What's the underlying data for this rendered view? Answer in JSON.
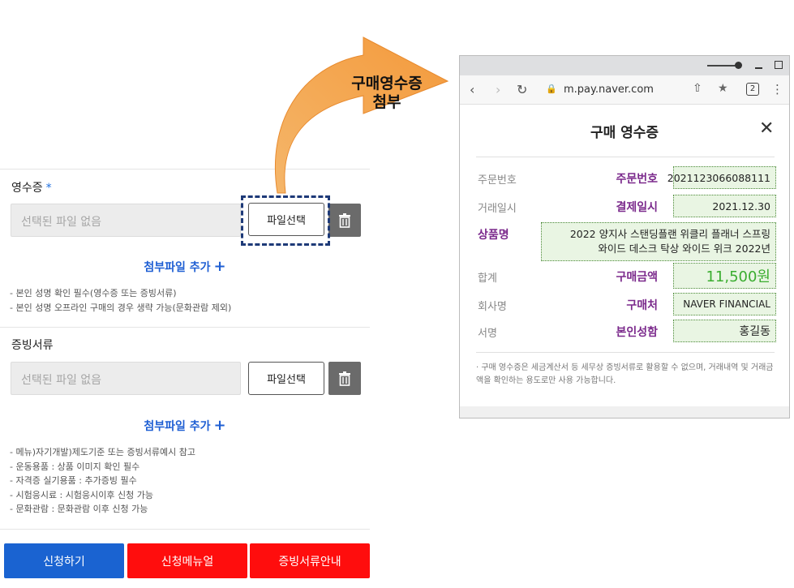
{
  "arrow": {
    "line1": "구매영수증",
    "line2": "첨부"
  },
  "form": {
    "receipt": {
      "title": "영수증",
      "required_mark": "*",
      "placeholder": "선택된 파일 없음",
      "select_button": "파일선택",
      "add_link": "첨부파일 추가",
      "add_icon": "+",
      "notes": [
        "- 본인 성명 확인 필수(영수증 또는 증빙서류)",
        "- 본인 성명 오프라인 구매의 경우 생략 가능(문화관람 제외)"
      ]
    },
    "evidence": {
      "title": "증빙서류",
      "placeholder": "선택된 파일 없음",
      "select_button": "파일선택",
      "add_link": "첨부파일 추가",
      "add_icon": "+",
      "notes": [
        "- 메뉴)자기개발)제도기준 또는 증빙서류예시 참고",
        "- 운동용품 : 상품 이미지 확인 필수",
        "- 자격증 실기용품 : 추가증빙 필수",
        "- 시험응시료 : 시험응시이후 신청 가능",
        "- 문화관람 : 문화관람 이후 신청 가능"
      ]
    },
    "buttons": {
      "apply": "신청하기",
      "manual": "신청메뉴얼",
      "guide": "증빙서류안내"
    }
  },
  "browser": {
    "url": "m.pay.naver.com",
    "tab_count": "2",
    "receipt": {
      "title": "구매 영수증",
      "rows": [
        {
          "label": "주문번호",
          "key": "주문번호",
          "value": "2021123066088111"
        },
        {
          "label": "거래일시",
          "key": "결제일시",
          "value": "2021.12.30"
        },
        {
          "label": "상품명",
          "key": "",
          "value_line1": "2022 양지사 스탠딩플랜 위클리 플래너 스프링",
          "value_line2": "와이드 데스크 탁상 와이드 위크 2022년"
        },
        {
          "label": "합계",
          "key": "구매금액",
          "value": "11,500원"
        },
        {
          "label": "회사명",
          "key": "구매처",
          "value": "NAVER FINANCIAL"
        },
        {
          "label": "서명",
          "key": "본인성함",
          "value": "홍길동"
        }
      ],
      "note": "· 구매 영수증은 세금계산서 등 세무상 증빙서류로 활용할 수 없으며, 거래내역 및 거래금액을 확인하는 용도로만 사용 가능합니다."
    }
  },
  "colors": {
    "blue": "#1a63d1",
    "red": "#ff0d0d",
    "purple": "#7b2a8c",
    "green_fill": "#e9f5e3",
    "amount_green": "#3aad2f",
    "arrow_orange": "#f5a94e"
  }
}
